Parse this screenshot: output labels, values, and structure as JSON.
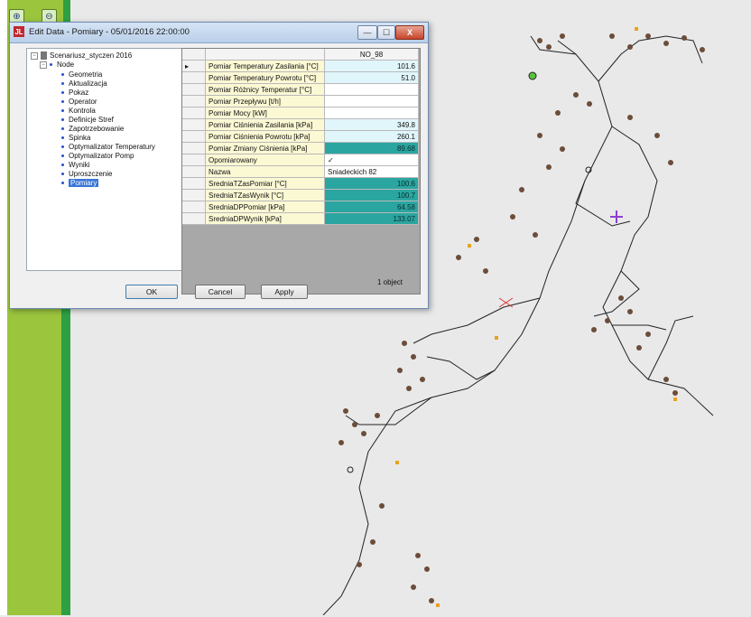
{
  "toolbar": {
    "zoom_in_icon": "magnifier-plus",
    "zoom_out_icon": "magnifier-minus"
  },
  "dialog": {
    "title": "Edit Data - Pomiary - 05/01/2016 22:00:00",
    "app_icon_text": "JL",
    "min_label": "—",
    "max_label": "☐",
    "close_label": "X",
    "tree": {
      "root": "Scenariusz_styczen 2016",
      "node": "Node",
      "items": [
        "Geometria",
        "Aktualizacja",
        "Pokaz",
        "Operator",
        "Kontrola",
        "Definicje Stref",
        "Zapotrzebowanie",
        "Spinka",
        "Optymalizator Temperatury",
        "Optymalizator Pomp",
        "Wyniki",
        "Uproszczenie",
        "Pomiary"
      ]
    },
    "grid": {
      "column_header": "NO_98",
      "rows": [
        {
          "name": "Pomiar Temperatury Zasilania [°C]",
          "value": "101.6"
        },
        {
          "name": "Pomiar Temperatury Powrotu [°C]",
          "value": "51.0"
        },
        {
          "name": "Pomiar Różnicy Temperatur [°C]",
          "value": ""
        },
        {
          "name": "Pomiar Przepływu [t/h]",
          "value": ""
        },
        {
          "name": "Pomiar Mocy [kW]",
          "value": ""
        },
        {
          "name": "Pomiar Ciśnienia Zasilania [kPa]",
          "value": "349.8"
        },
        {
          "name": "Pomiar Ciśnienia Powrotu [kPa]",
          "value": "260.1"
        },
        {
          "name": "Pomiar Zmiany Ciśnienia [kPa]",
          "value": "89.68"
        },
        {
          "name": "Opomiarowany",
          "value": "✓"
        },
        {
          "name": "Nazwa",
          "value": "Sniadeckich 82"
        },
        {
          "name": "SredniaTZasPomiar [°C]",
          "value": "100.6"
        },
        {
          "name": "SredniaTZasWynik [°C]",
          "value": "100.7"
        },
        {
          "name": "SredniaDPPomiar [kPa]",
          "value": "64.58"
        },
        {
          "name": "SredniaDPWynik [kPa]",
          "value": "133.07"
        }
      ]
    },
    "object_count": "1 object",
    "buttons": {
      "ok": "OK",
      "cancel": "Cancel",
      "apply": "Apply"
    }
  },
  "colors": {
    "app_green": "#9bc53d",
    "dark_green": "#2ea043",
    "teal": "#2aa5a0",
    "selection": "#3875d7"
  }
}
